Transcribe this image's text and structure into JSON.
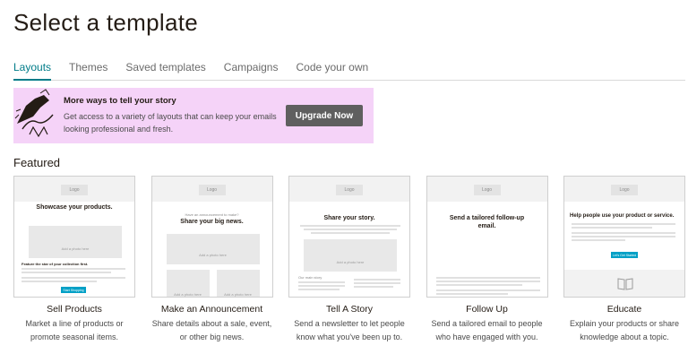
{
  "page": {
    "title": "Select a template"
  },
  "tabs": [
    {
      "label": "Layouts",
      "active": true
    },
    {
      "label": "Themes",
      "active": false
    },
    {
      "label": "Saved templates",
      "active": false
    },
    {
      "label": "Campaigns",
      "active": false
    },
    {
      "label": "Code your own",
      "active": false
    }
  ],
  "promo": {
    "heading": "More ways to tell your story",
    "body": "Get access to a variety of layouts that can keep your emails looking professional and fresh.",
    "button": "Upgrade Now",
    "illustration": "hand-drawn-figure-illustration"
  },
  "featured": {
    "label": "Featured",
    "cards": [
      {
        "title": "Sell Products",
        "description": "Market a line of products or promote seasonal items.",
        "thumb": {
          "logo": "Logo",
          "heading": "Showcase your products.",
          "photo": "Add a photo here",
          "subheading": "Feature the star of your collection first.",
          "button": "Start Shopping"
        }
      },
      {
        "title": "Make an Announcement",
        "description": "Share details about a sale, event, or other big news.",
        "thumb": {
          "logo": "Logo",
          "kicker": "Have an announcement to make?",
          "heading": "Share your big news.",
          "photo": "Add a photo here",
          "photo_small_1": "Add a photo here",
          "photo_small_2": "Add a photo here"
        }
      },
      {
        "title": "Tell A Story",
        "description": "Send a newsletter to let people know what you've been up to.",
        "thumb": {
          "logo": "Logo",
          "heading": "Share your story.",
          "photo": "Add a photo here",
          "col_heading": "Our main story"
        }
      },
      {
        "title": "Follow Up",
        "description": "Send a tailored email to people who have engaged with you.",
        "thumb": {
          "logo": "Logo",
          "heading": "Send a tailored follow-up email."
        }
      },
      {
        "title": "Educate",
        "description": "Explain your products or share knowledge about a topic.",
        "thumb": {
          "logo": "Logo",
          "heading": "Help people use your product or service.",
          "button": "Let's Get Started"
        }
      }
    ]
  },
  "colors": {
    "accent": "#007c89",
    "promo_bg": "#f5d3f8",
    "button_bg": "#5f5f5f",
    "cta": "#00a0c6"
  }
}
